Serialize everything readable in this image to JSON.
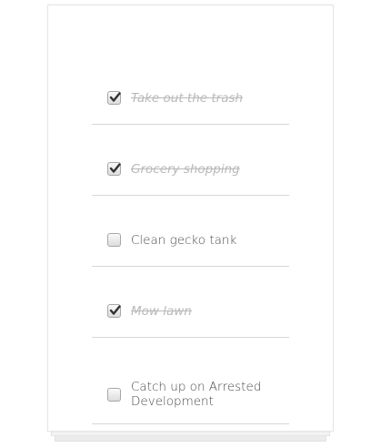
{
  "todos": {
    "items": [
      {
        "label": "Take out the trash",
        "checked": true
      },
      {
        "label": "Grocery shopping",
        "checked": true
      },
      {
        "label": "Clean gecko tank",
        "checked": false
      },
      {
        "label": "Mow lawn",
        "checked": true
      },
      {
        "label": "Catch up on Arrested Development",
        "checked": false
      }
    ]
  }
}
